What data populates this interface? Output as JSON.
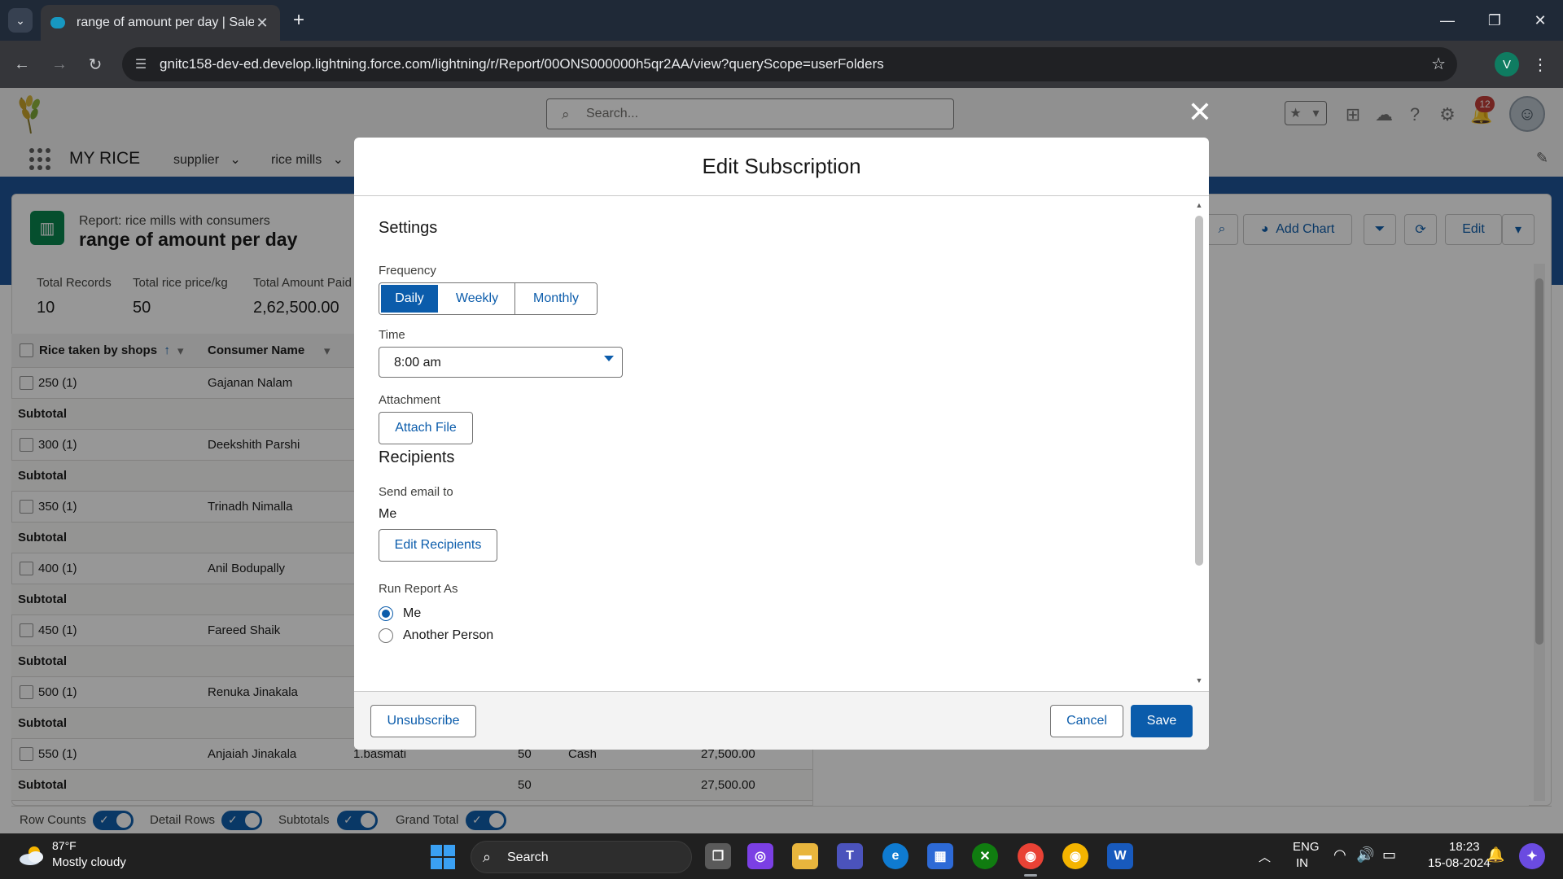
{
  "browser": {
    "tab_title": "range of amount per day | Sales",
    "url": "gnitc158-dev-ed.develop.lightning.force.com/lightning/r/Report/00ONS000000h5qr2AA/view?queryScope=userFolders",
    "profile_initial": "V"
  },
  "sf_header": {
    "search_placeholder": "Search...",
    "notification_count": "12"
  },
  "nav": {
    "app_name": "MY RICE",
    "items": [
      "supplier",
      "rice mills"
    ]
  },
  "report": {
    "subtitle": "Report: rice mills with consumers",
    "title": "range of amount per day",
    "add_chart_label": "Add Chart",
    "edit_label": "Edit",
    "stats": [
      {
        "label": "Total Records",
        "value": "10"
      },
      {
        "label": "Total rice price/kg",
        "value": "50"
      },
      {
        "label": "Total Amount Paid",
        "value": "2,62,500.00"
      }
    ],
    "columns": [
      "Rice taken by shops",
      "Consumer Name"
    ],
    "rows": [
      {
        "shops": "250 (1)",
        "consumer": "Gajanan Nalam"
      },
      {
        "shops": "300 (1)",
        "consumer": "Deekshith Parshi"
      },
      {
        "shops": "350 (1)",
        "consumer": "Trinadh Nimalla"
      },
      {
        "shops": "400 (1)",
        "consumer": "Anil Bodupally"
      },
      {
        "shops": "450 (1)",
        "consumer": "Fareed Shaik"
      },
      {
        "shops": "500 (1)",
        "consumer": "Renuka Jinakala"
      },
      {
        "shops": "550 (1)",
        "consumer": "Anjaiah Jinakala",
        "rice": "1.basmati",
        "price": "50",
        "payment": "Cash",
        "amount": "27,500.00"
      }
    ],
    "subtotal_label": "Subtotal",
    "last_subtotal": {
      "price": "50",
      "amount": "27,500.00"
    },
    "toggles": [
      "Row Counts",
      "Detail Rows",
      "Subtotals",
      "Grand Total"
    ]
  },
  "modal": {
    "title": "Edit Subscription",
    "settings_heading": "Settings",
    "frequency_label": "Frequency",
    "frequency_options": [
      "Daily",
      "Weekly",
      "Monthly"
    ],
    "frequency_selected": "Daily",
    "time_label": "Time",
    "time_value": "8:00 am",
    "attachment_label": "Attachment",
    "attach_button": "Attach File",
    "recipients_heading": "Recipients",
    "send_email_label": "Send email to",
    "send_email_value": "Me",
    "edit_recipients_button": "Edit Recipients",
    "run_as_label": "Run Report As",
    "run_as_options": [
      "Me",
      "Another Person"
    ],
    "run_as_selected": "Me",
    "unsubscribe_button": "Unsubscribe",
    "cancel_button": "Cancel",
    "save_button": "Save"
  },
  "taskbar": {
    "temperature": "87°F",
    "weather": "Mostly cloudy",
    "search_label": "Search",
    "lang_top": "ENG",
    "lang_bottom": "IN",
    "time": "18:23",
    "date": "15-08-2024"
  },
  "colors": {
    "brand": "#0b5cab",
    "header_band": "#1b5297",
    "report_icon": "#04844b"
  }
}
